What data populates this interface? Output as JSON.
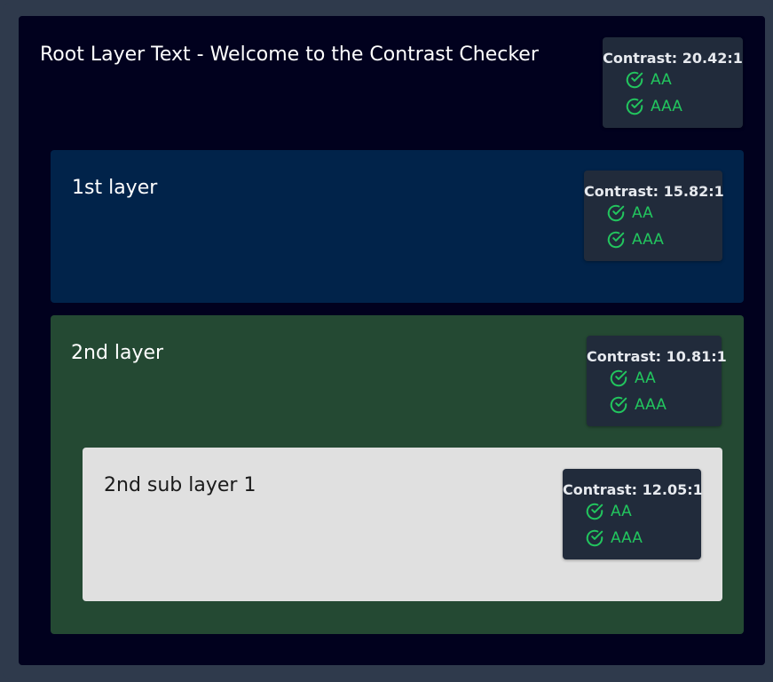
{
  "root": {
    "text": "Root Layer Text - Welcome to the Contrast Checker",
    "contrast": "Contrast: 20.42:1",
    "aa": "AA",
    "aaa": "AAA"
  },
  "layer1": {
    "text": "1st layer",
    "contrast": "Contrast: 15.82:1",
    "aa": "AA",
    "aaa": "AAA"
  },
  "layer2": {
    "text": "2nd layer",
    "contrast": "Contrast: 10.81:1",
    "aa": "AA",
    "aaa": "AAA"
  },
  "sublayer1": {
    "text": "2nd sub layer 1",
    "contrast": "Contrast: 12.05:1",
    "aa": "AA",
    "aaa": "AAA"
  },
  "colors": {
    "page_bg": "#2f3a4c",
    "root_bg": "#01011e",
    "layer1_bg": "#01234a",
    "layer2_bg": "#244933",
    "sublayer_bg": "#e0e0e0",
    "badge_bg": "#212b3b",
    "pass_green": "#22c55e"
  },
  "icons": {
    "pass": "check-circle-icon"
  }
}
